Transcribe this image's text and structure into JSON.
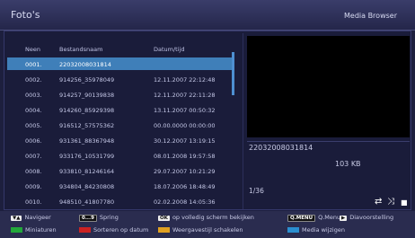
{
  "header": {
    "title": "Foto's",
    "mode": "Media Browser"
  },
  "columns": {
    "num": "Neen",
    "name": "Bestandsnaam",
    "date": "Datum/tijd"
  },
  "rows": [
    {
      "num": "0001.",
      "name": "22032008031814",
      "date": ""
    },
    {
      "num": "0002.",
      "name": "914256_35978049",
      "date": "12.11.2007 22:12:48"
    },
    {
      "num": "0003.",
      "name": "914257_90139838",
      "date": "12.11.2007 22:11:28"
    },
    {
      "num": "0004.",
      "name": "914260_85929398",
      "date": "13.11.2007 00:50:32"
    },
    {
      "num": "0005.",
      "name": "916512_57575362",
      "date": "00.00.0000 00:00:00"
    },
    {
      "num": "0006.",
      "name": "931361_88367948",
      "date": "30.12.2007 13:19:15"
    },
    {
      "num": "0007.",
      "name": "933176_10531799",
      "date": "08.01.2008 19:57:58"
    },
    {
      "num": "0008.",
      "name": "933810_81246164",
      "date": "29.07.2007 10:21:29"
    },
    {
      "num": "0009.",
      "name": "934804_84230808",
      "date": "18.07.2006 18:48:49"
    },
    {
      "num": "0010.",
      "name": "948510_41807780",
      "date": "02.02.2008 14:05:36"
    }
  ],
  "detail": {
    "filename": "22032008031814",
    "size": "103 KB",
    "counter": "1/36"
  },
  "controls": {
    "repeat": "⇄",
    "shuffle": "⤨",
    "stop": "■"
  },
  "footer": {
    "navigate_key": "▼▲",
    "navigate": "Navigeer",
    "jump_key": "0...9",
    "jump": "Spring",
    "ok_key": "OK",
    "ok": "op volledig scherm bekijken",
    "menu_key": "Q.MENU",
    "menu": "Q.Menu",
    "play_key": "▶",
    "play": "Diavoorstelling",
    "green": "Miniaturen",
    "red": "Sorteren op datum",
    "yellow": "Weergavestijl schakelen",
    "blue": "Media wijzigen",
    "green_color": "#22a83a",
    "red_color": "#cc2222",
    "yellow_color": "#e0a020",
    "blue_color": "#2a8fd0"
  }
}
